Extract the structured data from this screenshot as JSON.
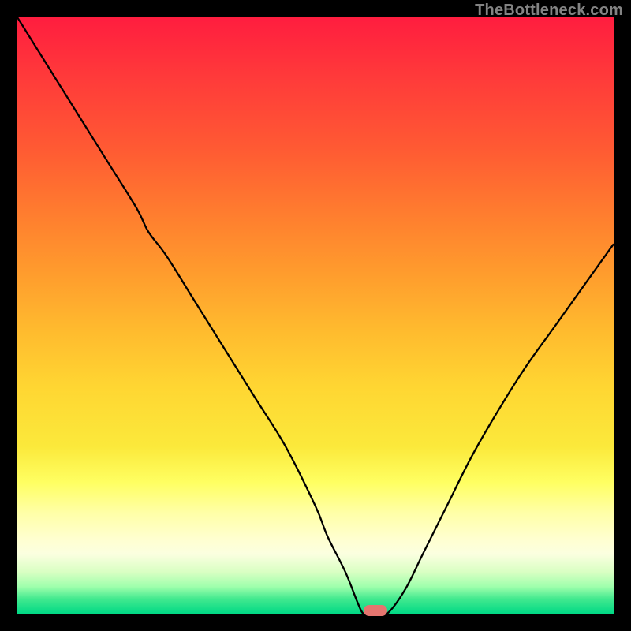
{
  "watermark": {
    "text": "TheBottleneck.com"
  },
  "chart_data": {
    "type": "line",
    "title": "",
    "xlabel": "",
    "ylabel": "",
    "xlim": [
      0,
      100
    ],
    "ylim": [
      0,
      100
    ],
    "grid": false,
    "legend": false,
    "background": "vertical-rainbow-gradient (red→yellow→green)",
    "series": [
      {
        "name": "bottleneck-curve",
        "x": [
          0,
          5,
          10,
          15,
          20,
          22,
          25,
          30,
          35,
          40,
          45,
          50,
          52,
          55,
          57,
          58,
          59,
          60,
          62,
          65,
          68,
          72,
          76,
          80,
          85,
          90,
          95,
          100
        ],
        "y": [
          100,
          92,
          84,
          76,
          68,
          64,
          60,
          52,
          44,
          36,
          28,
          18,
          13,
          7,
          2,
          0,
          0,
          0,
          0,
          4,
          10,
          18,
          26,
          33,
          41,
          48,
          55,
          62
        ]
      }
    ],
    "marker": {
      "name": "optimal-point",
      "x": 60,
      "y": 0,
      "color": "#e5756f"
    }
  }
}
